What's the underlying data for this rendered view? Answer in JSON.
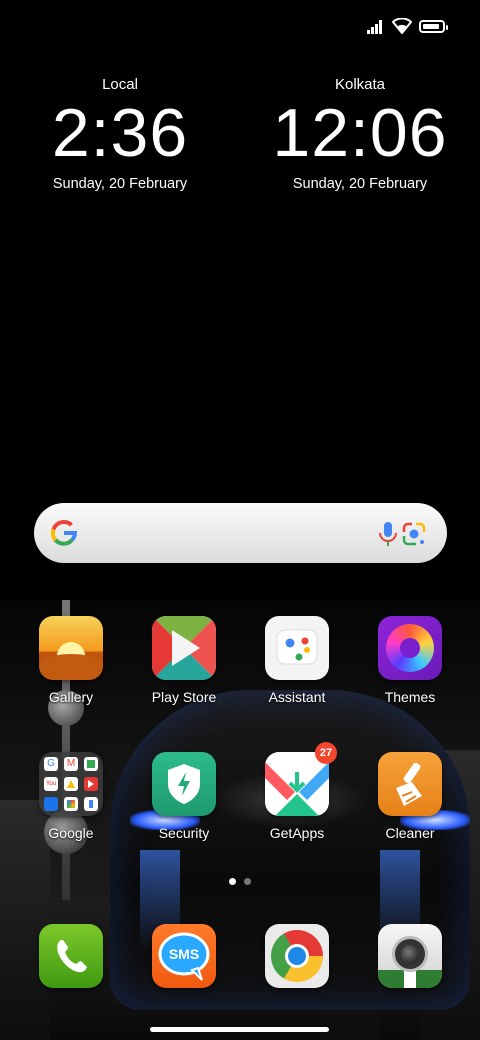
{
  "status_bar": {
    "signal_icon": "signal-icon",
    "wifi_icon": "wifi-icon",
    "battery_icon": "battery-icon",
    "battery_level": 0.9
  },
  "clocks": [
    {
      "city": "Local",
      "time": "2:36",
      "date": "Sunday, 20 February"
    },
    {
      "city": "Kolkata",
      "time": "12:06",
      "date": "Sunday, 20 February"
    }
  ],
  "search_widget": {
    "logo_icon": "google-g-icon",
    "mic_icon": "microphone-icon",
    "lens_icon": "google-lens-icon"
  },
  "apps": [
    {
      "label": "Gallery",
      "icon": "gallery-icon"
    },
    {
      "label": "Play Store",
      "icon": "play-store-icon"
    },
    {
      "label": "Assistant",
      "icon": "assistant-icon"
    },
    {
      "label": "Themes",
      "icon": "themes-icon"
    },
    {
      "label": "Google",
      "icon": "google-folder-icon"
    },
    {
      "label": "Security",
      "icon": "security-icon"
    },
    {
      "label": "GetApps",
      "icon": "getapps-icon",
      "badge": "27"
    },
    {
      "label": "Cleaner",
      "icon": "cleaner-icon"
    }
  ],
  "dock": [
    {
      "icon": "phone-icon"
    },
    {
      "icon": "sms-icon",
      "text": "SMS"
    },
    {
      "icon": "chrome-icon"
    },
    {
      "icon": "camera-icon"
    }
  ],
  "page_indicator": {
    "pages": 2,
    "current": 1
  },
  "colors": {
    "badge": "#f2462d",
    "background": "#000000"
  }
}
